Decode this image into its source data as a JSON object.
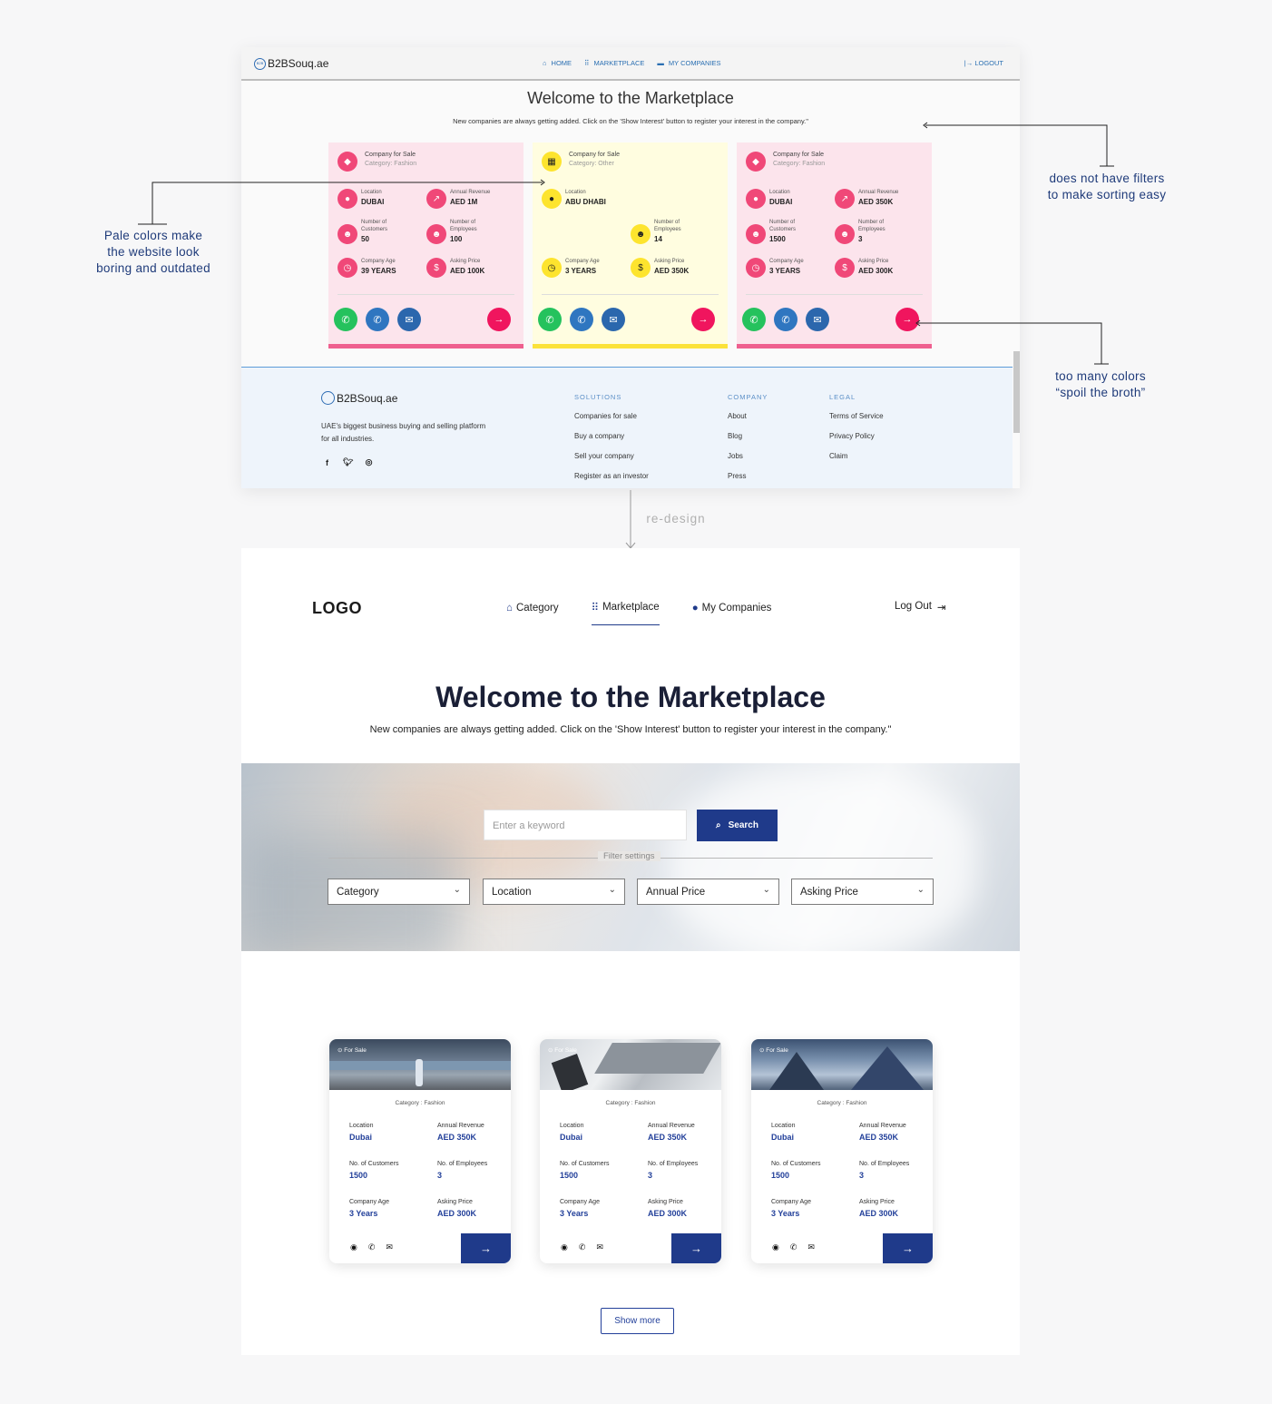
{
  "old": {
    "logo": "B2BSouq.ae",
    "nav": {
      "home": "HOME",
      "marketplace": "MARKETPLACE",
      "my_companies": "MY COMPANIES",
      "logout": "LOGOUT"
    },
    "title": "Welcome to the Marketplace",
    "subtitle": "New companies are always getting added. Click on the 'Show Interest' button to register your interest in the company.\"",
    "labels": {
      "location": "Location",
      "annual_revenue": "Annual Revenue",
      "customers": "Number of\nCustomers",
      "employees": "Number of\nEmployees",
      "company_age": "Company Age",
      "asking_price": "Asking Price"
    },
    "cards": [
      {
        "heading": "Company for Sale",
        "category": "Category: Fashion",
        "location": "DUBAI",
        "revenue": "AED 1M",
        "customers": "50",
        "employees": "100",
        "age": "39 YEARS",
        "price": "AED 100K"
      },
      {
        "heading": "Company for Sale",
        "category": "Category: Other",
        "location": "ABU DHABI",
        "employees": "14",
        "age": "3 YEARS",
        "price": "AED 350K"
      },
      {
        "heading": "Company for Sale",
        "category": "Category: Fashion",
        "location": "DUBAI",
        "revenue": "AED 350K",
        "customers": "1500",
        "employees": "3",
        "age": "3 YEARS",
        "price": "AED 300K"
      }
    ],
    "footer": {
      "logo": "B2BSouq.ae",
      "desc": "UAE's biggest business buying and selling platform for all industries.",
      "solutions": {
        "heading": "SOLUTIONS",
        "items": [
          "Companies for sale",
          "Buy a company",
          "Sell your company",
          "Register as an investor"
        ]
      },
      "company": {
        "heading": "COMPANY",
        "items": [
          "About",
          "Blog",
          "Jobs",
          "Press"
        ]
      },
      "legal": {
        "heading": "LEGAL",
        "items": [
          "Terms of Service",
          "Privacy Policy",
          "Claim"
        ]
      }
    }
  },
  "annotations": {
    "filters": "does not have filters\nto make sorting easy",
    "pale": "Pale colors make\nthe website look\nboring and outdated",
    "colors": "too many colors\n“spoil the broth”",
    "redesign": "re-design"
  },
  "new": {
    "logo": "LOGO",
    "nav": {
      "category": "Category",
      "marketplace": "Marketplace",
      "my_companies": "My Companies",
      "logout": "Log Out"
    },
    "title": "Welcome to the Marketplace",
    "subtitle": "New companies are always getting added. Click on the 'Show Interest' button to register your interest in the company.\"",
    "search": {
      "placeholder": "Enter a keyword",
      "button": "Search"
    },
    "filter_label": "Filter settings",
    "filters": [
      "Category",
      "Location",
      "Annual Price",
      "Asking Price"
    ],
    "labels": {
      "location": "Location",
      "annual_revenue": "Annual Revenue",
      "customers": "No. of Customers",
      "employees": "No. of Employees",
      "company_age": "Company Age",
      "asking_price": "Asking Price"
    },
    "cards": [
      {
        "badge": "For Sale",
        "category": "Category : Fashion",
        "location": "Dubai",
        "revenue": "AED 350K",
        "customers": "1500",
        "employees": "3",
        "age": "3 Years",
        "price": "AED 300K"
      },
      {
        "badge": "For Sale",
        "category": "Category : Fashion",
        "location": "Dubai",
        "revenue": "AED 350K",
        "customers": "1500",
        "employees": "3",
        "age": "3 Years",
        "price": "AED 300K"
      },
      {
        "badge": "For Sale",
        "category": "Category : Fashion",
        "location": "Dubai",
        "revenue": "AED 350K",
        "customers": "1500",
        "employees": "3",
        "age": "3 Years",
        "price": "AED 300K"
      }
    ],
    "show_more": "Show more"
  },
  "colors": {
    "accent": "#1f3a8a",
    "old_pink": "#f04878",
    "old_yellow": "#fde42e",
    "whatsapp": "#25c25d",
    "phone": "#2f76c0",
    "mail": "#2b67ad",
    "go": "#f0155e"
  }
}
